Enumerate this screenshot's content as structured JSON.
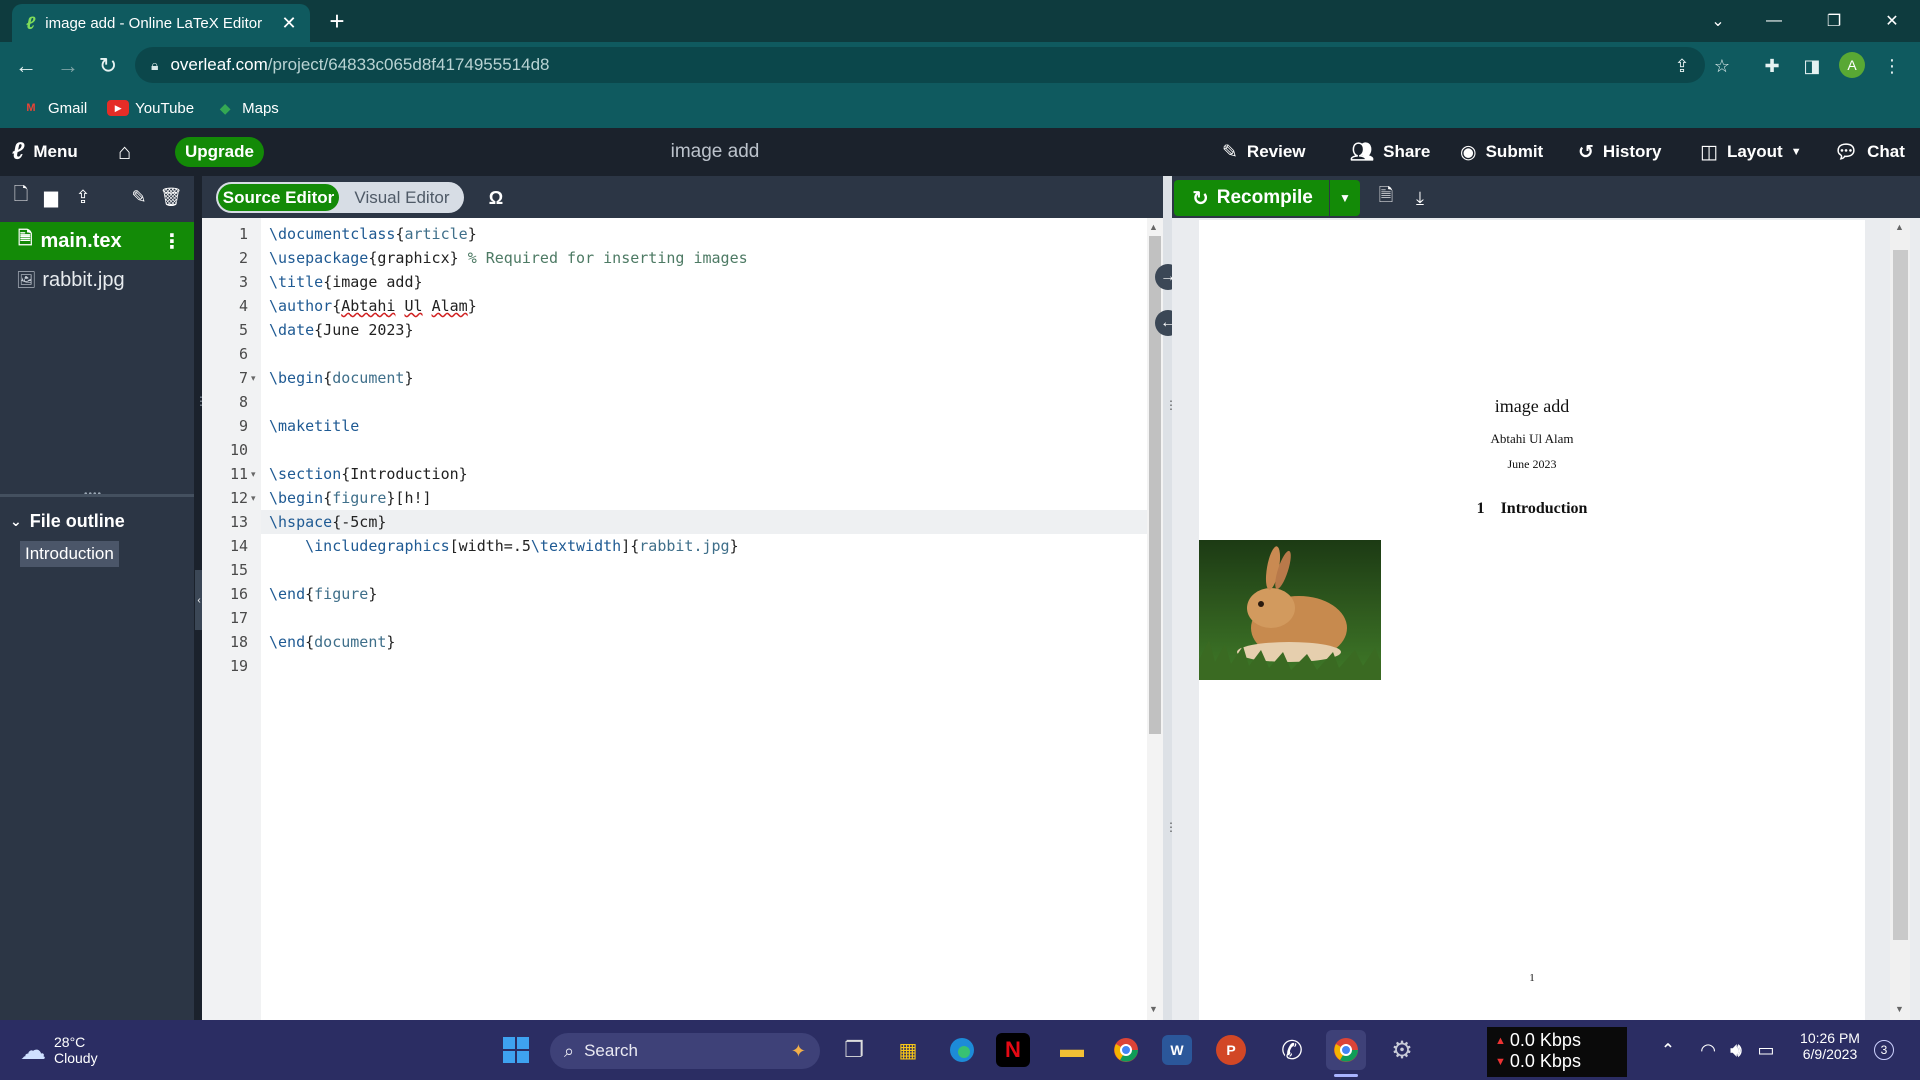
{
  "browser": {
    "tab_title": "image add - Online LaTeX Editor",
    "tab_close": "✕",
    "new_tab": "+",
    "url_host": "overleaf.com",
    "url_path": "/project/64833c065d8f4174955514d8",
    "avatar_letter": "A",
    "bookmarks": [
      {
        "label": "Gmail",
        "icon": "gmail-icon"
      },
      {
        "label": "YouTube",
        "icon": "youtube-icon"
      },
      {
        "label": "Maps",
        "icon": "maps-icon"
      }
    ]
  },
  "toolbar": {
    "menu": "Menu",
    "upgrade": "Upgrade",
    "project_name": "image add",
    "review": "Review",
    "share": "Share",
    "submit": "Submit",
    "history": "History",
    "layout": "Layout",
    "chat": "Chat"
  },
  "file_tree": {
    "files": [
      {
        "name": "main.tex",
        "selected": true
      },
      {
        "name": "rabbit.jpg",
        "selected": false
      }
    ],
    "outline_header": "File outline",
    "outline_items": [
      "Introduction"
    ]
  },
  "editor": {
    "source_label": "Source Editor",
    "visual_label": "Visual Editor",
    "symbol": "Ω",
    "current_line": 13,
    "lines": [
      "\\documentclass{article}",
      "\\usepackage{graphicx} % Required for inserting images",
      "\\title{image add}",
      "\\author{Abtahi Ul Alam}",
      "\\date{June 2023}",
      "",
      "\\begin{document}",
      "",
      "\\maketitle",
      "",
      "\\section{Introduction}",
      "\\begin{figure}[h!]",
      "\\hspace{-5cm}",
      "    \\includegraphics[width=.5\\textwidth]{rabbit.jpg}",
      "",
      "\\end{figure}",
      "",
      "\\end{document}",
      ""
    ]
  },
  "pdf": {
    "recompile": "Recompile",
    "title": "image add",
    "author": "Abtahi Ul Alam",
    "date": "June 2023",
    "section_number": "1",
    "section_title": "Introduction",
    "page_number": "1"
  },
  "taskbar": {
    "weather_temp": "28°C",
    "weather_desc": "Cloudy",
    "search": "Search",
    "net_up": "0.0 Kbps",
    "net_down": "0.0 Kbps",
    "time": "10:26 PM",
    "date": "6/9/2023",
    "notifications": "3"
  },
  "colors": {
    "overleaf_green": "#138a07",
    "toolbar_dark": "#1b222c",
    "panel_dark": "#2c3645",
    "browser_teal": "#0f5a5f",
    "taskbar": "#2b2d63"
  }
}
